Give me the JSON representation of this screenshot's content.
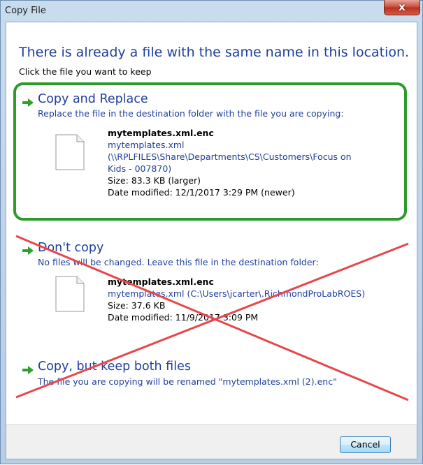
{
  "window": {
    "title": "Copy File",
    "close_label": "x"
  },
  "heading": "There is already a file with the same name in this location.",
  "instruction": "Click the file you want to keep",
  "options": {
    "replace": {
      "title": "Copy and Replace",
      "description": "Replace the file in the destination folder with the file you are copying:",
      "file_name": "mytemplates.xml.enc",
      "file_link_1": "mytemplates.xml",
      "file_link_2": "(\\\\RPLFILES\\Share\\Departments\\CS\\Customers\\Focus on",
      "file_link_3": "Kids - 007870)",
      "size": "Size: 83.3 KB (larger)",
      "date": "Date modified: 12/1/2017 3:29 PM (newer)"
    },
    "dont_copy": {
      "title": "Don't copy",
      "description": "No files will be changed. Leave this file in the destination folder:",
      "file_name": "mytemplates.xml.enc",
      "file_link": "mytemplates.xml (C:\\Users\\jcarter\\.RichmondProLabROES)",
      "size": "Size: 37.6 KB",
      "date": "Date modified: 11/9/2017 3:09 PM"
    },
    "keep_both": {
      "title": "Copy, but keep both files",
      "description": "The file you are copying will be renamed \"mytemplates.xml (2).enc\""
    }
  },
  "footer": {
    "cancel_label": "Cancel"
  },
  "icons": {
    "arrow": "green-arrow-icon",
    "file": "document-icon",
    "close": "close-icon"
  },
  "colors": {
    "link_blue": "#1e3f9b",
    "highlight_green": "#2e9a2c",
    "cross_red": "#e8474a",
    "arrow_green": "#2ea02a"
  }
}
